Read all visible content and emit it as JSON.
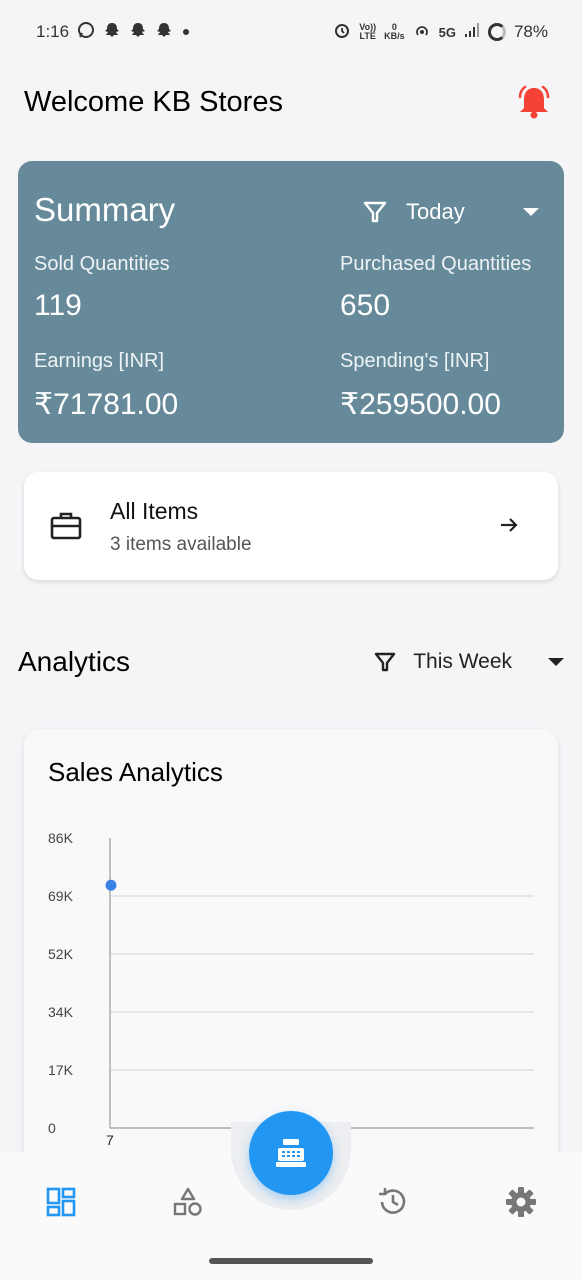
{
  "status_bar": {
    "time": "1:16",
    "network": "5G",
    "kbs_top": "0",
    "kbs_bottom": "KB/s",
    "volte_top": "Vo))",
    "volte_bottom": "LTE",
    "battery": "78%",
    "icons": [
      "whatsapp-icon",
      "snapchat-icon",
      "snapchat-icon",
      "snapchat-icon",
      "dot-icon",
      "alarm-icon",
      "volte-icon",
      "data-speed-icon",
      "hotspot-icon",
      "signal-icon",
      "battery-icon"
    ]
  },
  "header": {
    "title": "Welcome KB Stores",
    "bell_color": "#f44336"
  },
  "summary": {
    "title": "Summary",
    "filter": "Today",
    "sold_label": "Sold Quantities",
    "sold_value": "119",
    "purchased_label": "Purchased Quantities",
    "purchased_value": "650",
    "earnings_label": "Earnings [INR]",
    "earnings_value": "₹71781.00",
    "spending_label": "Spending's [INR]",
    "spending_value": "₹259500.00",
    "bg_color": "#668a9a"
  },
  "items_card": {
    "title": "All Items",
    "subtitle": "3 items available"
  },
  "analytics": {
    "title": "Analytics",
    "filter": "This Week"
  },
  "chart_data": {
    "type": "line",
    "title": "Sales Analytics",
    "xlabel": "",
    "ylabel": "",
    "y_ticks": [
      "0",
      "17K",
      "34K",
      "52K",
      "69K",
      "86K"
    ],
    "ylim": [
      0,
      86000
    ],
    "x_ticks": [
      "7"
    ],
    "series": [
      {
        "values": [
          {
            "x": 7,
            "y": 72000
          }
        ],
        "color": "#3b82e6"
      }
    ],
    "grid": true
  },
  "bottom_nav": {
    "items": [
      "dashboard-icon",
      "categories-icon",
      "history-icon",
      "settings-icon"
    ],
    "fab": "cash-register-icon",
    "accent": "#2196f3"
  }
}
